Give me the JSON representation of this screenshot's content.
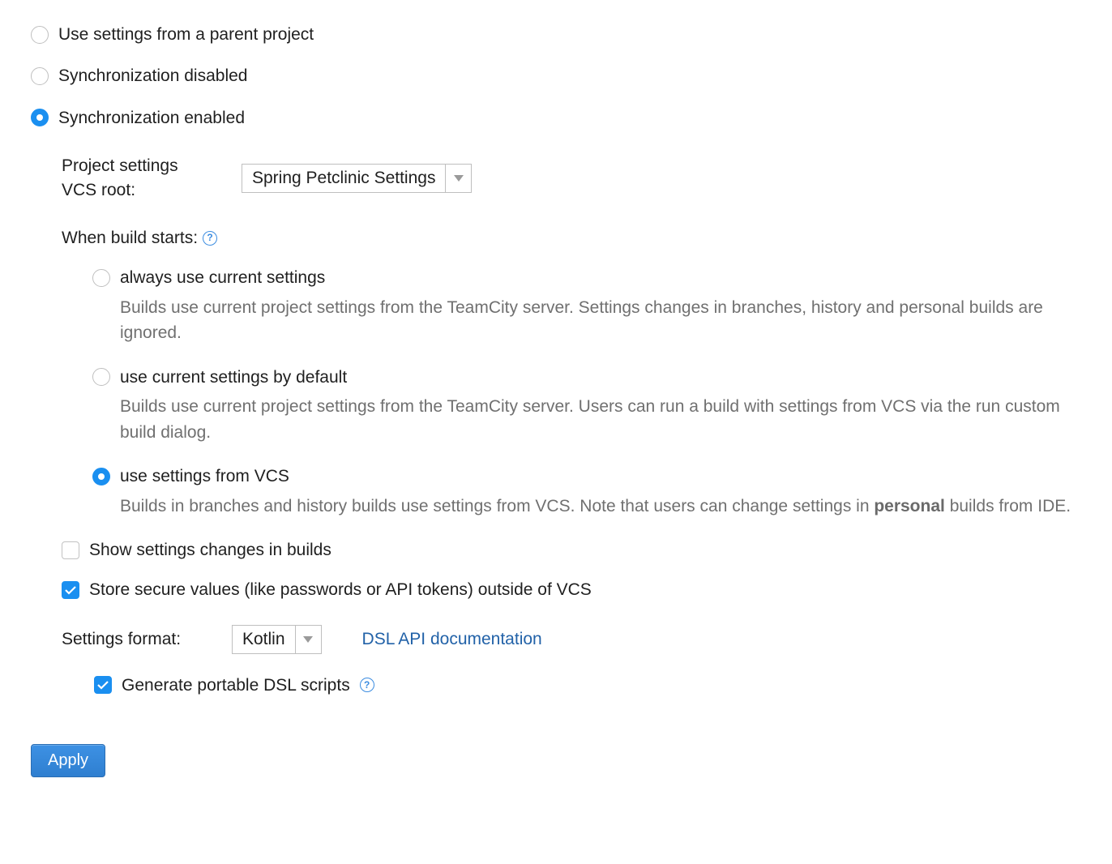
{
  "syncOptions": {
    "parent": "Use settings from a parent project",
    "disabled": "Synchronization disabled",
    "enabled": "Synchronization enabled"
  },
  "vcsRoot": {
    "labelLine1": "Project settings",
    "labelLine2": "VCS root:",
    "selected": "Spring Petclinic Settings"
  },
  "whenBuildStarts": {
    "label": "When build starts:",
    "options": {
      "always": {
        "title": "always use current settings",
        "desc": "Builds use current project settings from the TeamCity server. Settings changes in branches, history and personal builds are ignored."
      },
      "default": {
        "title": "use current settings by default",
        "desc": "Builds use current project settings from the TeamCity server. Users can run a build with settings from VCS via the run custom build dialog."
      },
      "vcs": {
        "title": "use settings from VCS",
        "descPrefix": "Builds in branches and history builds use settings from VCS. Note that users can change settings in ",
        "descBold": "personal",
        "descSuffix": " builds from IDE."
      }
    }
  },
  "checkboxes": {
    "showChanges": "Show settings changes in builds",
    "storeSecure": "Store secure values (like passwords or API tokens) outside of VCS",
    "portable": "Generate portable DSL scripts"
  },
  "format": {
    "label": "Settings format:",
    "selected": "Kotlin",
    "docLink": "DSL API documentation"
  },
  "buttons": {
    "apply": "Apply"
  }
}
